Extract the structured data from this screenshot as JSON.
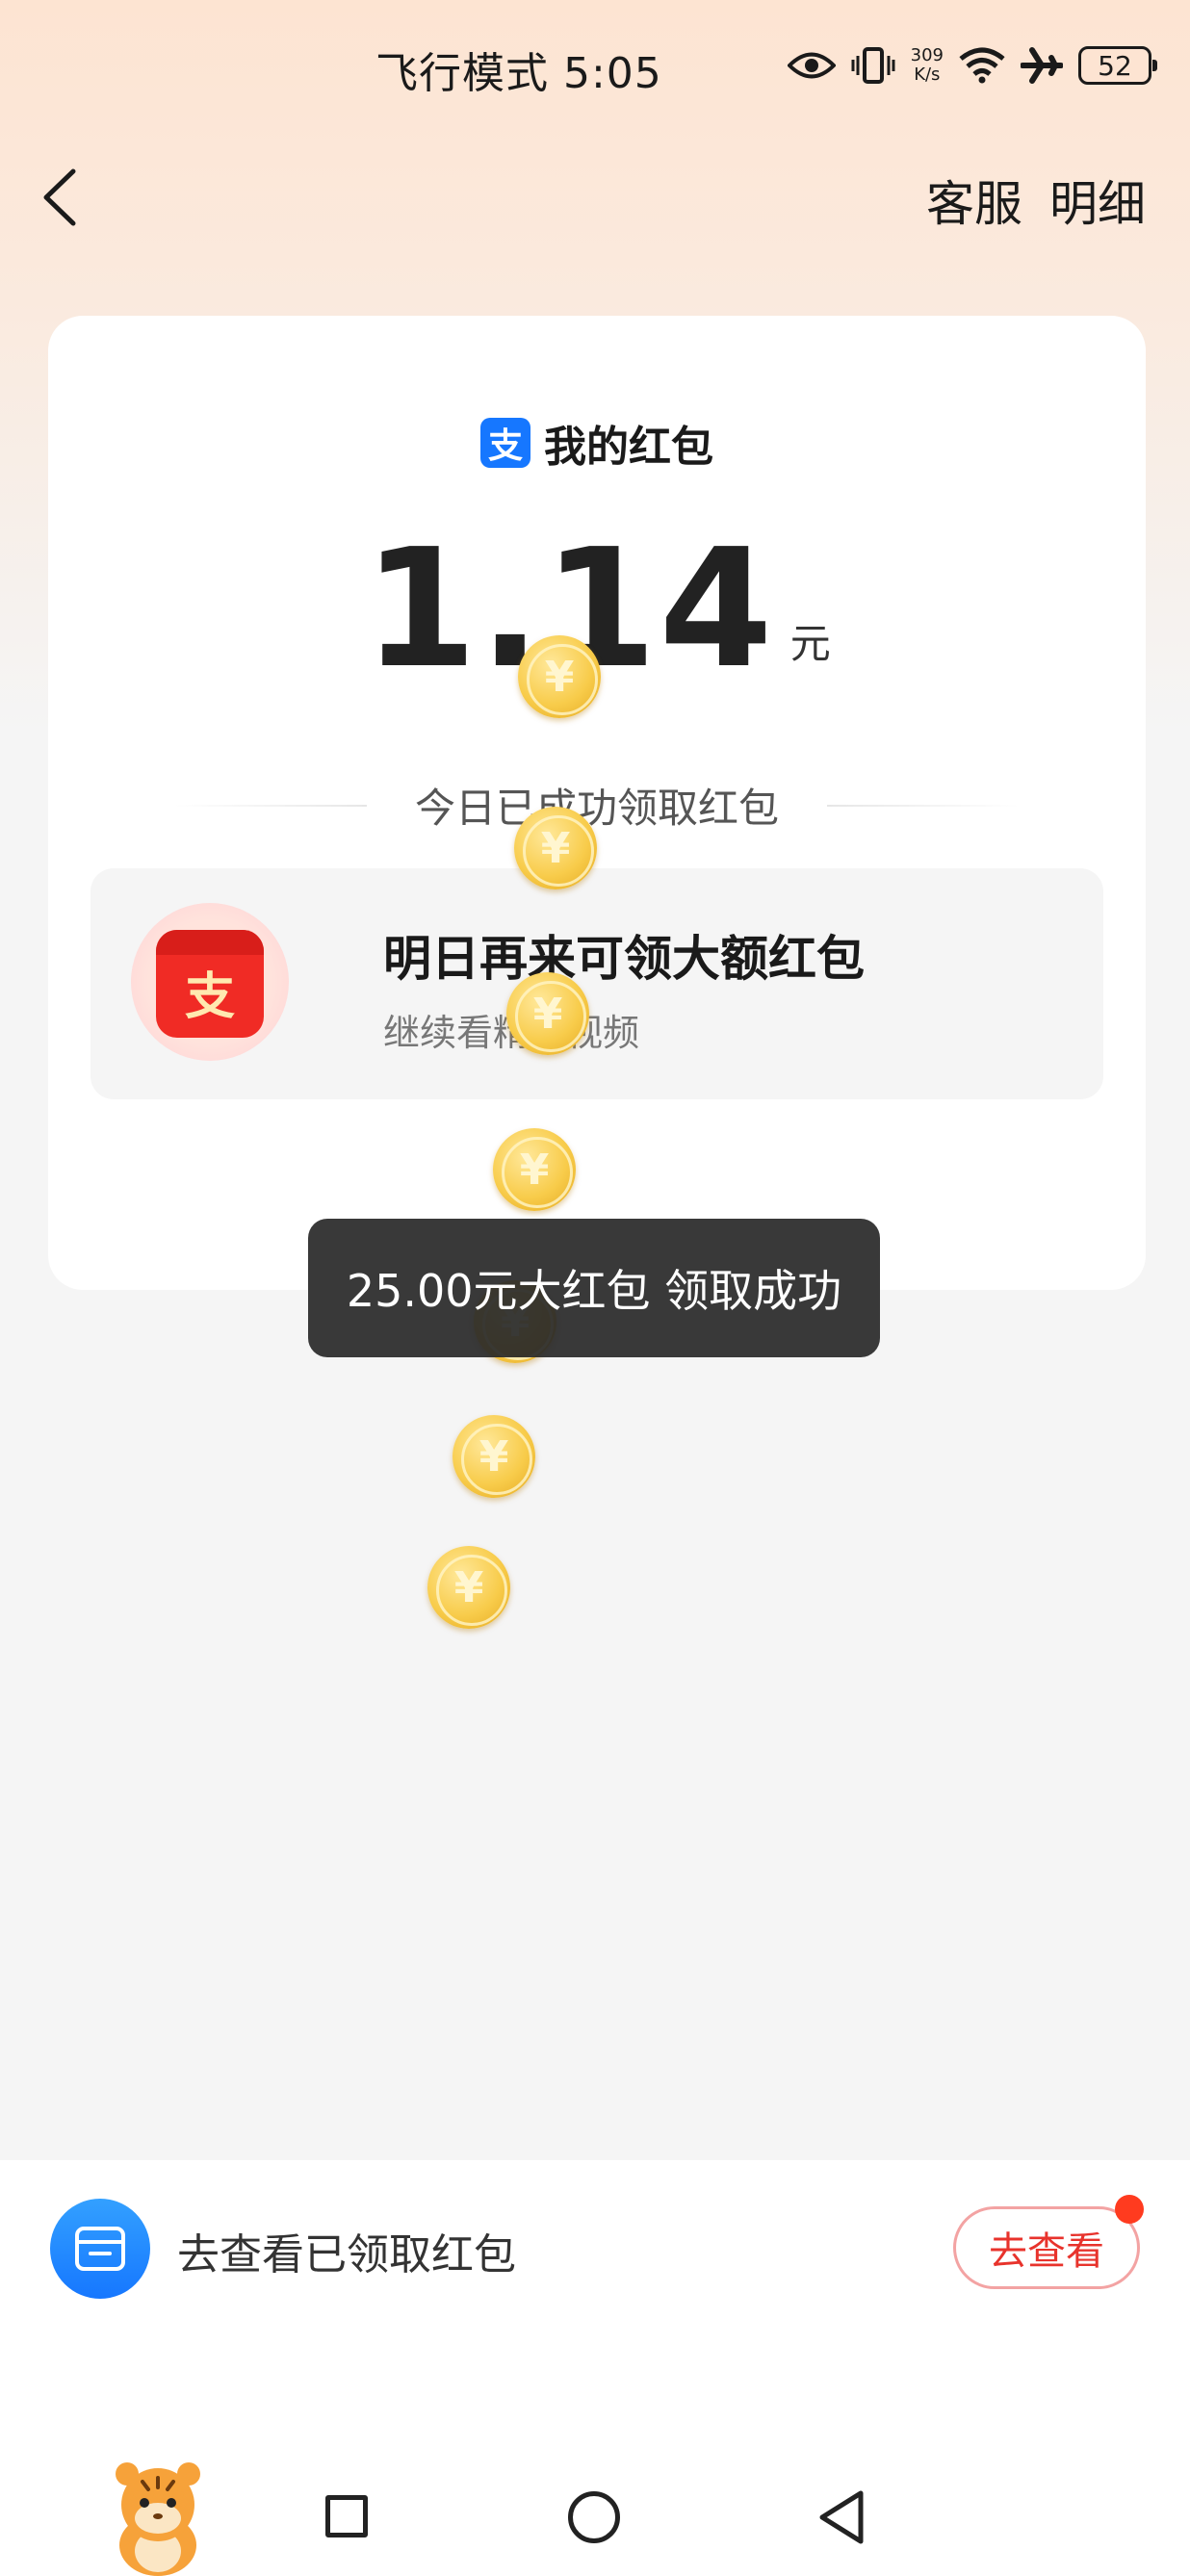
{
  "status_bar": {
    "time": "飞行模式 5:05",
    "net_speed_value": "309",
    "net_speed_unit": "K/s",
    "battery": "52",
    "icons": [
      "eye-icon",
      "vibrate-icon",
      "wifi-icon",
      "airplane-icon",
      "battery-icon"
    ]
  },
  "nav": {
    "back_icon": "chevron-left-icon",
    "customer_service": "客服",
    "details": "明细"
  },
  "card": {
    "logo_char": "支",
    "title": "我的红包",
    "amount": "1.14",
    "unit": "元",
    "divider_text": "今日已成功领取红包",
    "promo": {
      "icon_char": "支",
      "title": "明日再来可领大额红包",
      "subtitle": "继续看精彩视频"
    }
  },
  "coins": {
    "symbol": "¥",
    "count_visible": 8
  },
  "toast": {
    "text": "25.00元大红包 领取成功"
  },
  "bottom": {
    "label": "去查看已领取红包",
    "button": "去查看",
    "has_red_dot": true
  },
  "colors": {
    "accent_blue": "#1677ff",
    "red": "#e8332c",
    "toast_bg": "#282828",
    "coin_gold": "#f8cc4b",
    "page_bg": "#f5f5f5"
  }
}
